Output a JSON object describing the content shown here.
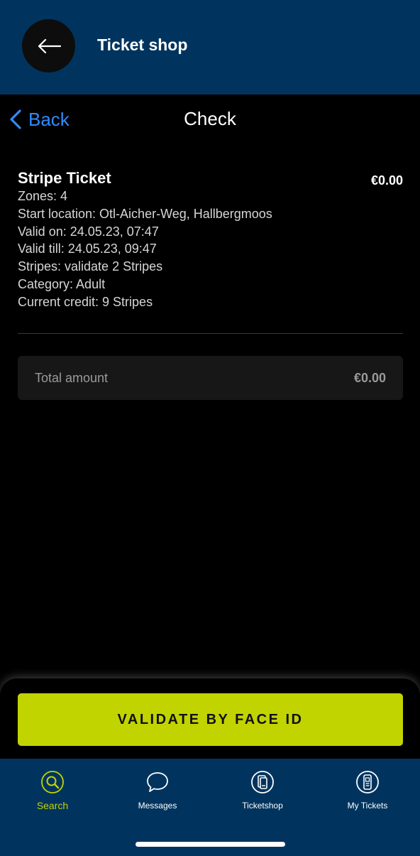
{
  "header": {
    "title": "Ticket shop"
  },
  "subnav": {
    "back_label": "Back",
    "title": "Check"
  },
  "ticket": {
    "name": "Stripe Ticket",
    "price": "€0.00",
    "details": [
      "Zones: 4",
      "Start location: Otl-Aicher-Weg, Hallbergmoos",
      "Valid on: 24.05.23, 07:47",
      "Valid till: 24.05.23, 09:47",
      "Stripes: validate 2 Stripes",
      "Category: Adult",
      "Current credit: 9 Stripes"
    ]
  },
  "total": {
    "label": "Total amount",
    "value": "€0.00"
  },
  "action": {
    "validate_label": "VALIDATE BY FACE ID"
  },
  "tabs": [
    {
      "label": "Search",
      "icon": "search-icon",
      "active": true
    },
    {
      "label": "Messages",
      "icon": "speech-bubble-icon",
      "active": false
    },
    {
      "label": "Ticketshop",
      "icon": "ticketshop-icon",
      "active": false
    },
    {
      "label": "My Tickets",
      "icon": "my-tickets-icon",
      "active": false
    }
  ],
  "colors": {
    "header_bg": "#00345e",
    "accent": "#c2d400",
    "link": "#2f8cff",
    "background": "#000000"
  }
}
